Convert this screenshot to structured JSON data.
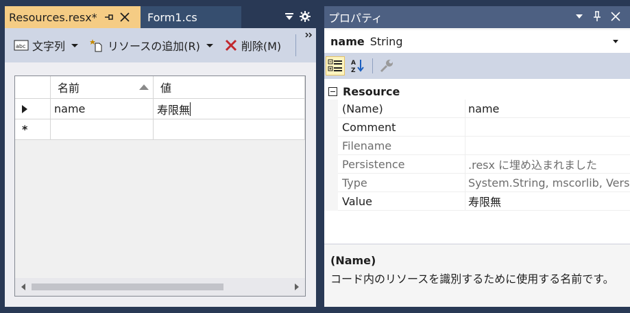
{
  "document": {
    "tabs": [
      {
        "label": "Resources.resx*",
        "active": true
      },
      {
        "label": "Form1.cs",
        "active": false
      }
    ],
    "toolbar": {
      "string_label": "文字列",
      "add_resource_label": "リソースの追加(R)",
      "delete_label": "削除(M)"
    },
    "grid": {
      "columns": [
        "名前",
        "値"
      ],
      "rows": [
        {
          "marker": "▶",
          "name": "name",
          "value": "寿限無"
        },
        {
          "marker": "*",
          "name": "",
          "value": ""
        }
      ]
    }
  },
  "properties": {
    "title": "プロパティ",
    "object_name": "name",
    "object_type": "String",
    "category": "Resource",
    "rows": [
      {
        "name": "(Name)",
        "value": "name",
        "readonly": false
      },
      {
        "name": "Comment",
        "value": "",
        "readonly": false
      },
      {
        "name": "Filename",
        "value": "",
        "readonly": true
      },
      {
        "name": "Persistence",
        "value": ".resx に埋め込まれました",
        "readonly": true
      },
      {
        "name": "Type",
        "value": "System.String, mscorlib, Vers",
        "readonly": true
      },
      {
        "name": "Value",
        "value": "寿限無",
        "readonly": false
      }
    ],
    "description": {
      "title": "(Name)",
      "text": "コード内のリソースを識別するために使用する名前です。"
    }
  },
  "colors": {
    "shell": "#293955",
    "active_tab": "#f5cc84",
    "toolbar": "#cfd6e5",
    "delete_icon": "#c1272d"
  }
}
